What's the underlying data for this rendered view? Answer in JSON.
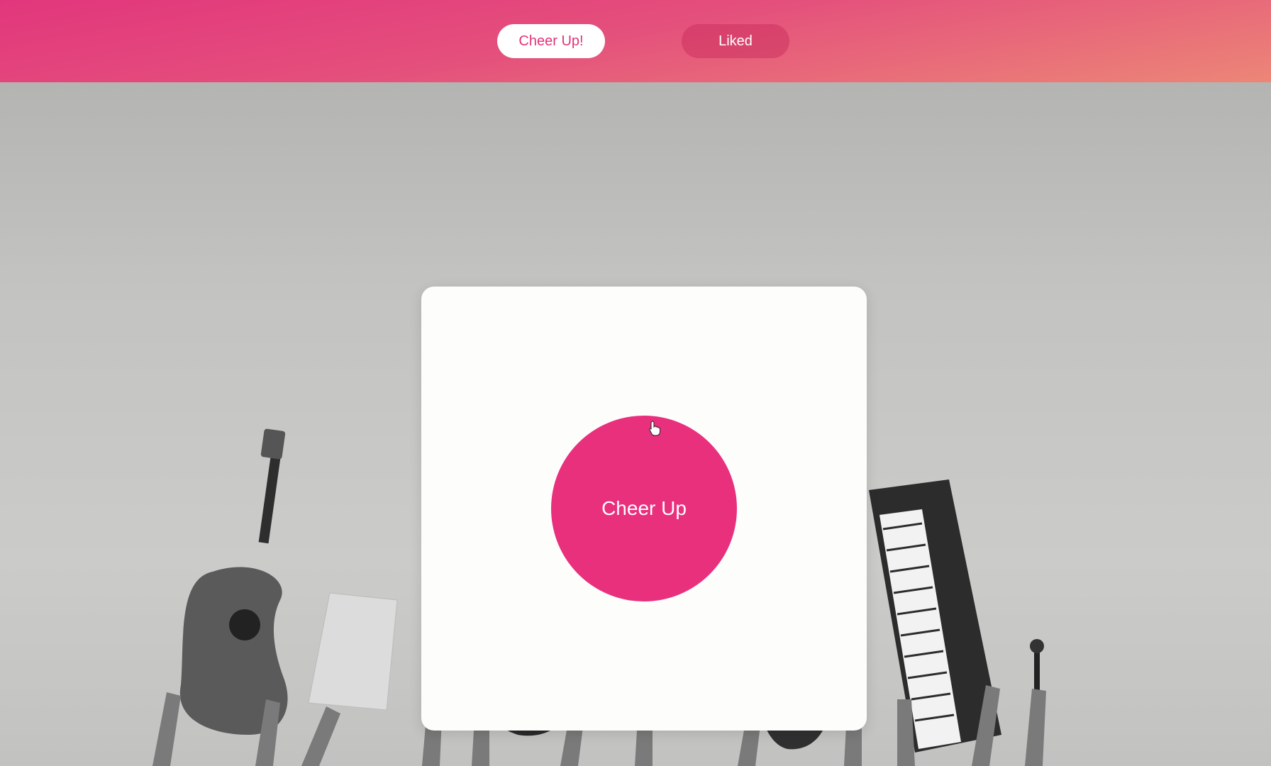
{
  "nav": {
    "cheer_up_label": "Cheer Up!",
    "liked_label": "Liked"
  },
  "card": {
    "button_label": "Cheer Up"
  },
  "background": {
    "image_description_icon": "band-instruments-photo"
  },
  "colors": {
    "accent": "#e8307d",
    "header_start": "#e2367c",
    "header_end": "#ec8677"
  }
}
